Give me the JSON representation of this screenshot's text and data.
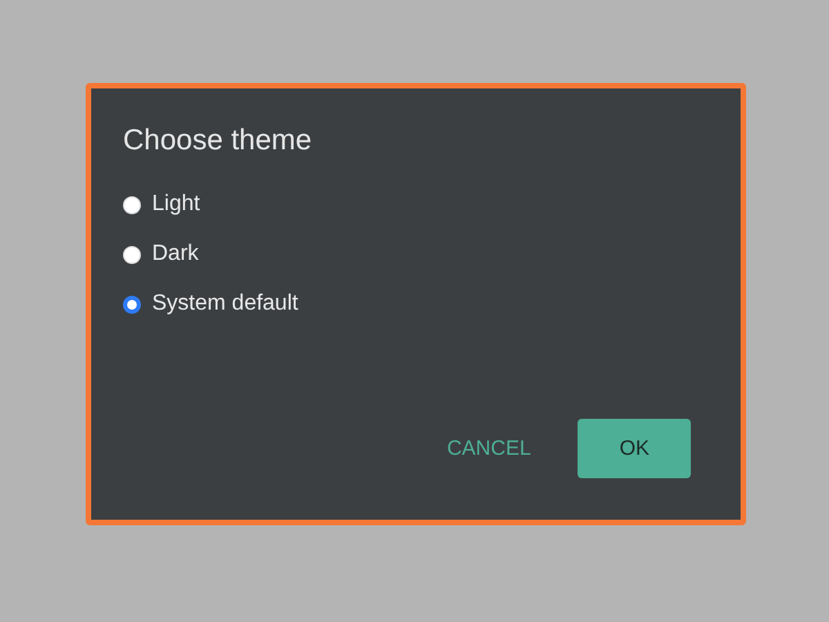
{
  "dialog": {
    "title": "Choose theme",
    "options": [
      {
        "label": "Light",
        "selected": false
      },
      {
        "label": "Dark",
        "selected": false
      },
      {
        "label": "System default",
        "selected": true
      }
    ],
    "buttons": [
      {
        "label": "CANCEL",
        "kind": "text"
      },
      {
        "label": "OK",
        "kind": "filled"
      }
    ]
  }
}
